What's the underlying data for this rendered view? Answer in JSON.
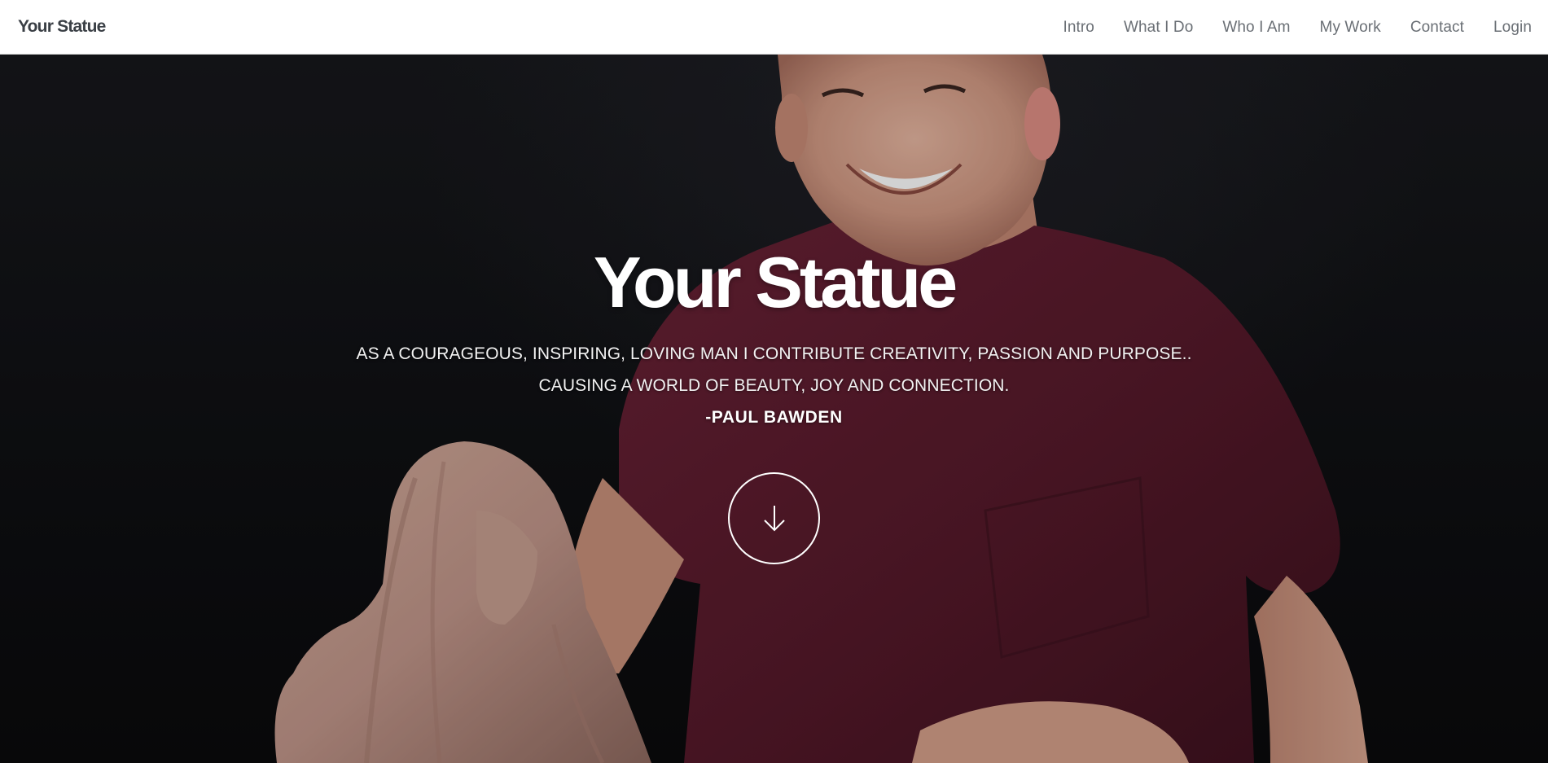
{
  "header": {
    "brand": "Your Statue",
    "nav": [
      {
        "label": "Intro"
      },
      {
        "label": "What I Do"
      },
      {
        "label": "Who I Am"
      },
      {
        "label": "My Work"
      },
      {
        "label": "Contact"
      },
      {
        "label": "Login"
      }
    ]
  },
  "hero": {
    "title": "Your Statue",
    "line1": "AS A COURAGEOUS, INSPIRING, LOVING MAN I CONTRIBUTE CREATIVITY, PASSION AND PURPOSE..",
    "line2": "CAUSING A WORLD OF BEAUTY, JOY AND CONNECTION.",
    "author": "-PAUL BAWDEN",
    "scroll_icon": "arrow-down-icon"
  },
  "colors": {
    "header_bg": "#ffffff",
    "brand_text": "#3a3f45",
    "nav_text": "#6a6f75",
    "hero_bg": "#0f1013",
    "shirt": "#5a1a2c",
    "skin": "#d7a48e",
    "statue": "#c49b8a",
    "hero_text": "#ffffff"
  }
}
